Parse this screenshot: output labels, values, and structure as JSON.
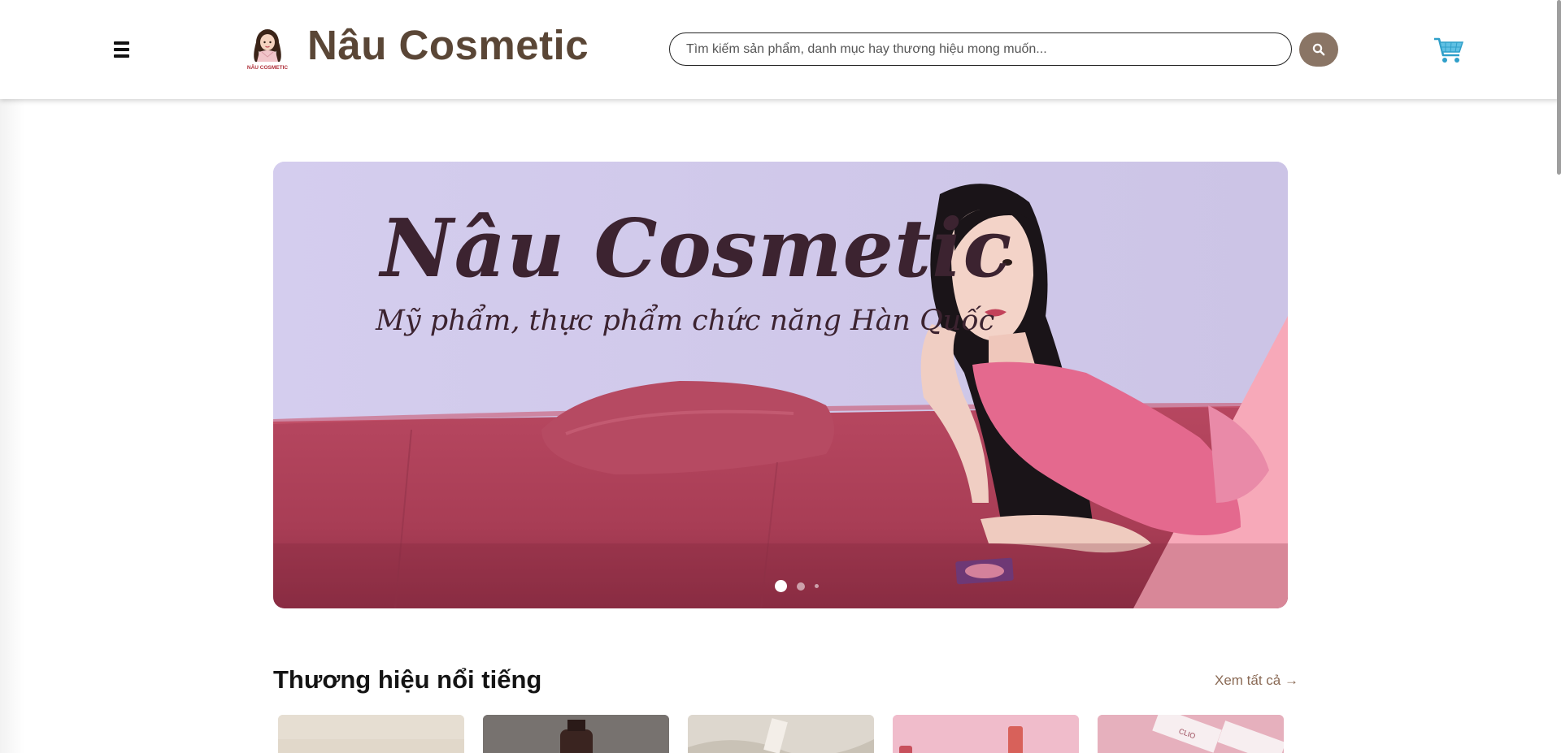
{
  "header": {
    "logo_caption": "NÂU COSMETIC",
    "site_name": "Nâu Cosmetic",
    "search": {
      "placeholder": "Tìm kiếm sản phẩm, danh mục hay thương hiệu mong muốn...",
      "value": ""
    },
    "icons": {
      "menu": "hamburger-menu-icon",
      "search": "search-icon",
      "cart": "shopping-cart-icon"
    }
  },
  "banner": {
    "title": "Nâu Cosmetic",
    "subtitle": "Mỹ phẩm, thực phẩm chức năng Hàn Quốc",
    "slides_total": 3,
    "active_slide": 1
  },
  "brands": {
    "title": "Thương hiệu nổi tiếng",
    "view_all": "Xem tất cả →",
    "cards": [
      {
        "name": "",
        "tone": "#e4dcd0"
      },
      {
        "name": "",
        "tone": "#8a8784"
      },
      {
        "name": "",
        "tone": "#e3ded6"
      },
      {
        "name": "",
        "tone": "#f3c4cf"
      },
      {
        "name": "CLIO",
        "tone": "#ecb9c4"
      }
    ]
  },
  "colors": {
    "brand_brown": "#5a4636",
    "search_button": "#8a7565",
    "link": "#8a6a55"
  }
}
